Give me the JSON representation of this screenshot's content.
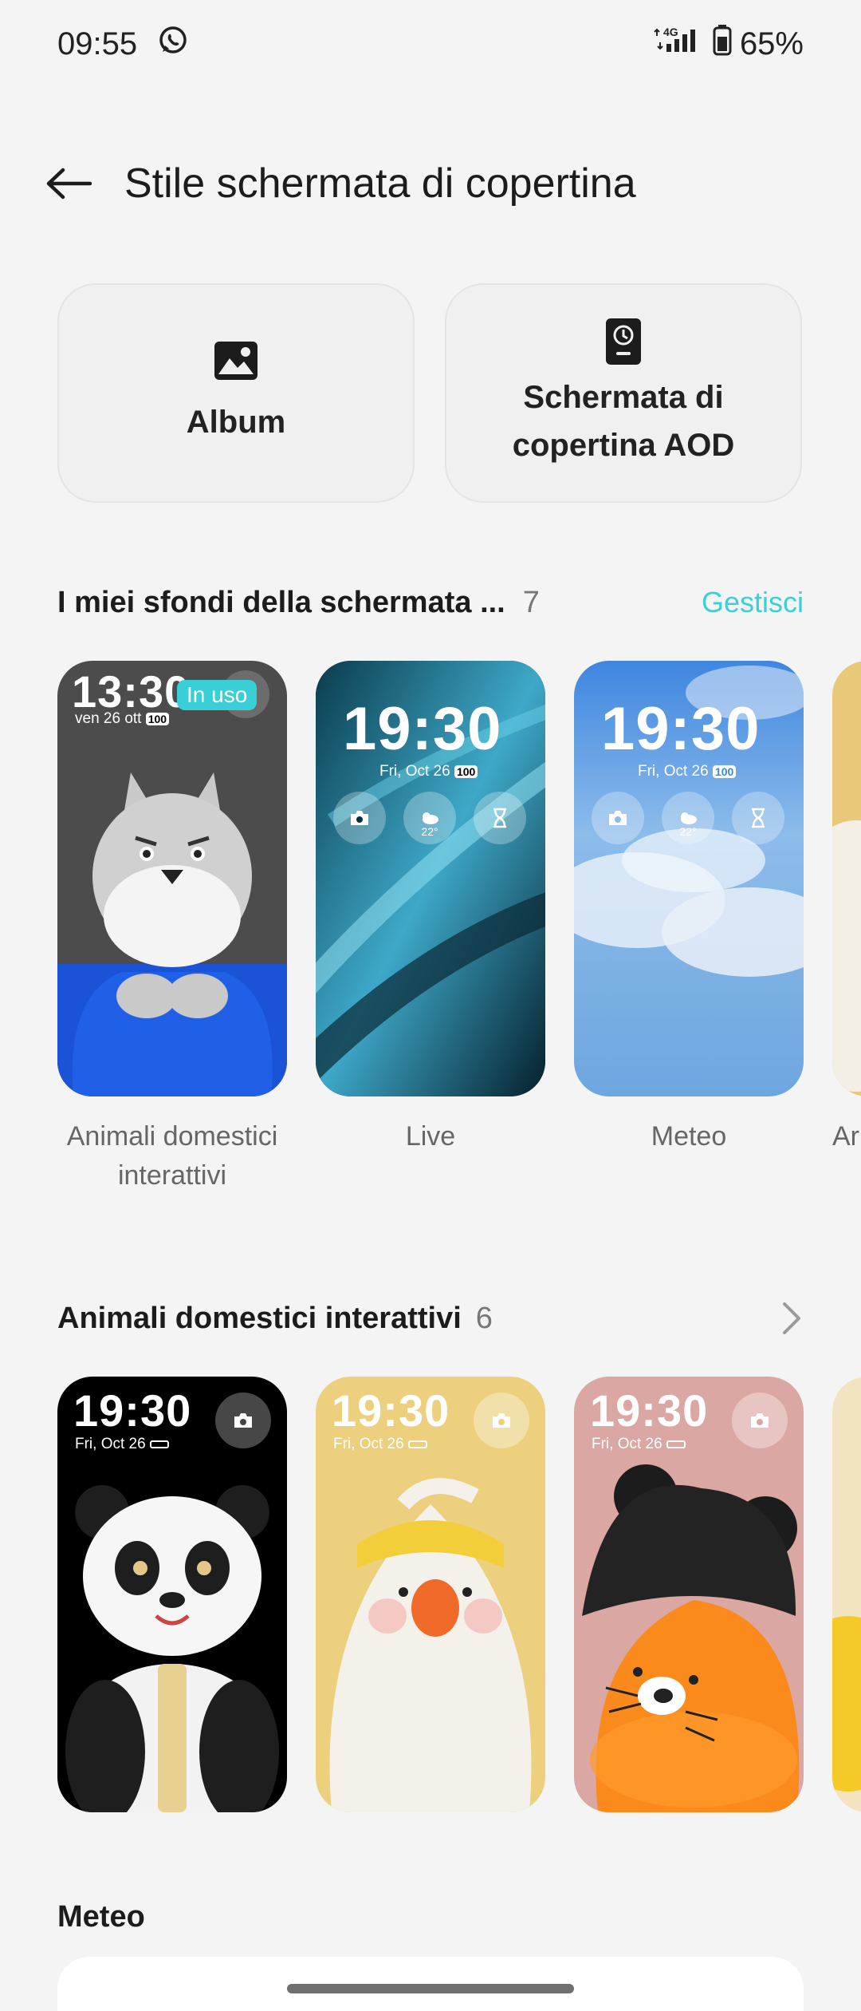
{
  "status_bar": {
    "time": "09:55",
    "battery": "65%",
    "network": "4G"
  },
  "header": {
    "title": "Stile schermata di copertina"
  },
  "actions": [
    {
      "label": "Album",
      "icon": "image-icon"
    },
    {
      "label": "Schermata di copertina AOD",
      "icon": "aod-clock-icon"
    }
  ],
  "my_wallpapers": {
    "title": "I miei sfondi della schermata ...",
    "count": "7",
    "manage": "Gestisci",
    "in_use_badge": "In uso",
    "items": [
      {
        "label": "Animali domestici interattivi",
        "clock": "13:30",
        "date": "ven 26 ott",
        "battery": "100"
      },
      {
        "label": "Live",
        "clock": "19:30",
        "date": "Fri, Oct 26",
        "battery": "100",
        "temp": "22°"
      },
      {
        "label": "Meteo",
        "clock": "19:30",
        "date": "Fri, Oct 26",
        "battery": "100",
        "temp": "22°"
      },
      {
        "label": "Ar"
      }
    ]
  },
  "pets_section": {
    "title": "Animali domestici interattivi",
    "count": "6",
    "items": [
      {
        "clock": "19:30",
        "date": "Fri, Oct 26",
        "bg": "#000000"
      },
      {
        "clock": "19:30",
        "date": "Fri, Oct 26",
        "bg": "#ecd07e"
      },
      {
        "clock": "19:30",
        "date": "Fri, Oct 26",
        "bg": "#dba7a3"
      }
    ]
  },
  "weather_section": {
    "title": "Meteo"
  }
}
